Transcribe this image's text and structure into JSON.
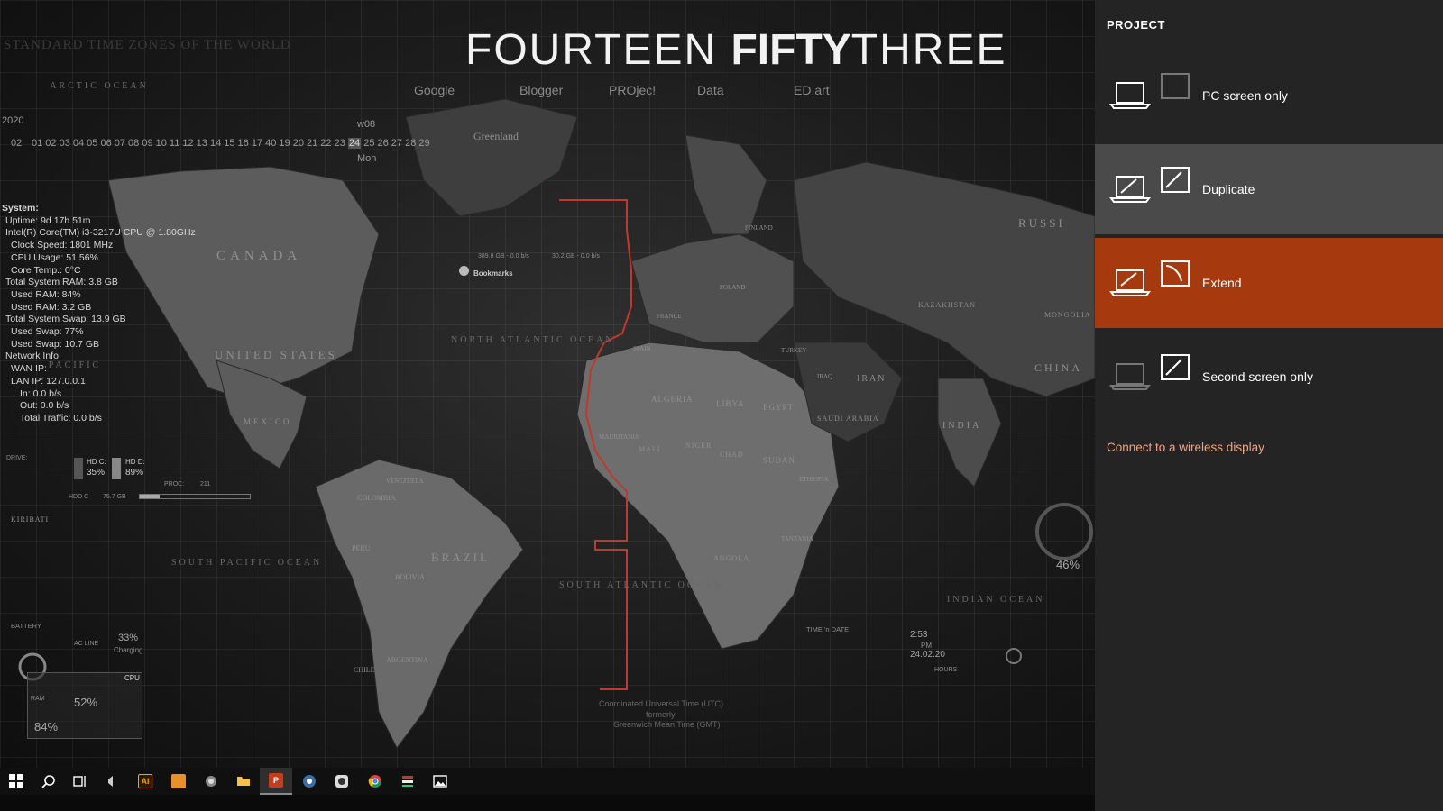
{
  "desktop": {
    "map_title": "STANDARD TIME ZONES OF THE WORLD",
    "logo": {
      "part1": "FOURTEEN",
      "part2": "FIFTY",
      "part3": "THREE"
    },
    "nav": [
      "Google",
      "Blogger",
      "PROjec!",
      "Data",
      "ED.art"
    ],
    "calendar": {
      "year": "2020",
      "month": "02",
      "week": "w08",
      "weekday": "Mon",
      "days_before": "01 02 03 04 05 06 07 08 09 10 11 12 13 14 15 16 17 40 19 20 21 22 23",
      "today": "24",
      "days_after": "25 26 27 28 29"
    },
    "system": {
      "heading": "System:",
      "uptime": "Uptime: 9d 17h 51m",
      "cpu": "Intel(R) Core(TM) i3-3217U CPU @ 1.80GHz",
      "clock": "Clock Speed: 1801 MHz",
      "cpu_usage": "CPU Usage: 51.56%",
      "core_temp": "Core Temp.: 0°C",
      "total_ram": "Total System RAM: 3.8 GB",
      "used_ram_pct": "Used RAM: 84%",
      "used_ram": "Used RAM: 3.2 GB",
      "total_swap": "Total System Swap: 13.9 GB",
      "used_swap_pct": "Used Swap: 77%",
      "used_swap": "Used Swap: 10.7 GB",
      "network": "Network Info",
      "wan": "WAN IP:",
      "lan": "LAN IP: 127.0.0.1",
      "in": "In: 0.0 b/s",
      "out": "Out: 0.0 b/s",
      "traffic": "Total Traffic: 0.0 b/s"
    },
    "drive": {
      "label": "DRIVE:",
      "hdc_label": "HD C:",
      "hdc_pct": "35%",
      "hdd_label": "HD D:",
      "hdd_pct": "89%",
      "hdd_bar_label": "HDD C",
      "hdd_bar_value": "75.7 GB",
      "proc_label": "PROC:",
      "proc_value": "211"
    },
    "disk_speeds": {
      "a": "389.8 GB - 0.0 b/s",
      "b": "30.2 GB - 0.0 b/s"
    },
    "bookmarks": "Bookmarks",
    "battery": {
      "label": "BATTERY",
      "ac": "AC LINE",
      "pct": "33%",
      "status": "Charging"
    },
    "cpu_ram_widget": {
      "cpu": "CPU",
      "ram": "RAM",
      "pct1": "52%",
      "pct2": "84%"
    },
    "clock_widget": {
      "label": "TIME 'n DATE",
      "time": "2:53",
      "ampm": "PM",
      "date": "24.02.20",
      "hours": "HOURS"
    },
    "gauge_pct": "46%",
    "countries": [
      "CANADA",
      "UNITED STATES",
      "MEXICO",
      "BRAZIL",
      "ALGERIA",
      "LIBYA",
      "EGYPT",
      "SUDAN",
      "NIGER",
      "CHAD",
      "MALI",
      "MAURITANIA",
      "SAUDI ARABIA",
      "IRAN",
      "KAZAKHSTAN",
      "MONGOLIA",
      "CHINA",
      "INDIA",
      "RUSSI",
      "ANGOLA",
      "ETHIOPIA",
      "TANZANIA",
      "PERU",
      "BOLIVIA",
      "ARGENTINA",
      "CHILE",
      "COLOMBIA",
      "VENEZUELA",
      "TURKEY",
      "IRAQ",
      "FINLAND",
      "POLAND",
      "SPAIN",
      "FRANCE",
      "KIRIBATI",
      "Greenland"
    ],
    "oceans": {
      "north_atlantic": "NORTH ATLANTIC OCEAN",
      "south_atlantic": "SOUTH ATLANTIC OCEAN",
      "south_pacific": "SOUTH PACIFIC OCEAN",
      "indian": "INDIAN OCEAN",
      "pacific": "PACIFIC",
      "arctic": "ARCTIC OCEAN"
    },
    "utc_note": [
      "Coordinated Universal Time (UTC)",
      "formerly",
      "Greenwich Mean Time (GMT)"
    ]
  },
  "taskbar": {
    "items": [
      {
        "name": "start-button",
        "icon": "windows-icon"
      },
      {
        "name": "search-button",
        "icon": "search-icon"
      },
      {
        "name": "task-view-button",
        "icon": "task-view-icon"
      },
      {
        "name": "pinned-app-1",
        "icon": "app-icon"
      },
      {
        "name": "illustrator-button",
        "icon": "illustrator-icon",
        "text": "Ai"
      },
      {
        "name": "sublime-button",
        "icon": "sublime-icon"
      },
      {
        "name": "app-gear-button",
        "icon": "gear-app-icon"
      },
      {
        "name": "file-explorer-button",
        "icon": "folder-icon"
      },
      {
        "name": "powerpoint-button",
        "icon": "powerpoint-icon",
        "text": "P"
      },
      {
        "name": "app-steam-button",
        "icon": "app-icon"
      },
      {
        "name": "camera-app-button",
        "icon": "camera-icon"
      },
      {
        "name": "chrome-button",
        "icon": "chrome-icon"
      },
      {
        "name": "app-list-button",
        "icon": "list-app-icon"
      },
      {
        "name": "photos-button",
        "icon": "photos-icon"
      }
    ],
    "accent": "#c0392b"
  },
  "project_panel": {
    "title": "PROJECT",
    "options": [
      {
        "label": "PC screen only",
        "selected": false
      },
      {
        "label": "Duplicate",
        "selected": false
      },
      {
        "label": "Extend",
        "selected": true
      },
      {
        "label": "Second screen only",
        "selected": false
      }
    ],
    "wireless": "Connect to a wireless display",
    "colors": {
      "selected_bg": "#a63a0e",
      "hover_bg": "#4a4a4a",
      "panel_bg": "#242424",
      "link": "#f0a486"
    }
  }
}
